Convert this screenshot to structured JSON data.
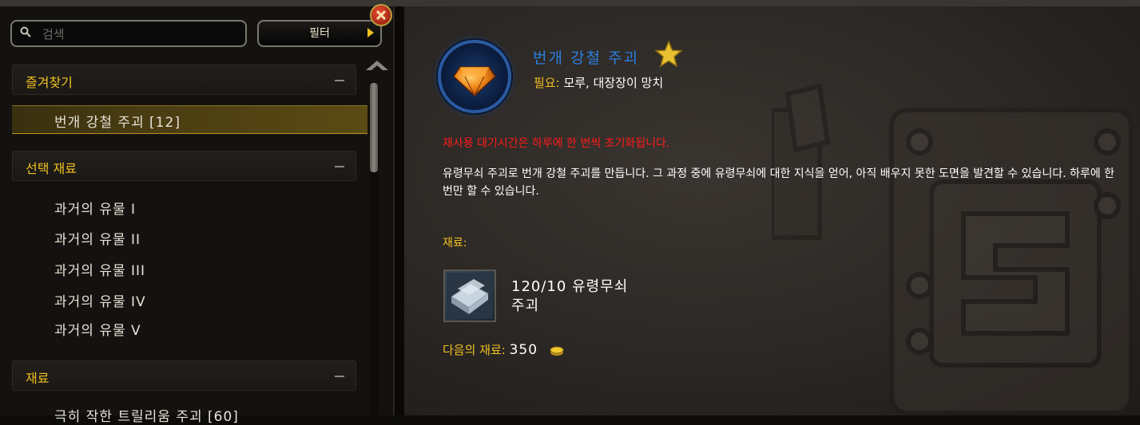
{
  "search": {
    "placeholder": "검색"
  },
  "filter": {
    "label": "필터"
  },
  "sections": [
    {
      "title": "즐겨찾기",
      "items": [
        {
          "label": "번개 강철 주괴 [12]",
          "selected": true
        }
      ]
    },
    {
      "title": "선택 재료",
      "items": [
        {
          "label": "과거의 유물 I"
        },
        {
          "label": "과거의 유물 II"
        },
        {
          "label": "과거의 유물 III"
        },
        {
          "label": "과거의 유물 IV"
        },
        {
          "label": "과거의 유물 V"
        }
      ]
    },
    {
      "title": "재료",
      "items": [
        {
          "label": "극히 작한 트릴리움 주괴 [60]"
        }
      ]
    }
  ],
  "detail": {
    "title": "번개 강철 주괴",
    "tools_label": "필요:",
    "tools_value": "모루, 대장장이 망치",
    "cooldown": "재사용 대기시간은 하루에 한 번씩 초기화됩니다.",
    "description": "유령무쇠 주괴로 번개 강철 주괴를 만듭니다. 그 과정 중에 유령무쇠에 대한 지식을 얻어, 아직 배우지 못한 도면을 발견할 수 있습니다. 하루에 한 번만 할 수 있습니다.",
    "materials_label": "재료:",
    "material": {
      "count": "120/10",
      "name": "유령무쇠",
      "name2": "주괴"
    },
    "next_label": "다음의 재료:",
    "next_value": "350"
  },
  "icons": {
    "recipe": "orange-gem-icon",
    "favorite": "gold-star-icon",
    "material": "ghost-iron-bar-icon",
    "currency": "gold-coin-icon",
    "close": "close-icon"
  },
  "colors": {
    "accent": "#f0c020",
    "title": "#2a7fe0",
    "warning": "#ff1a1a"
  }
}
